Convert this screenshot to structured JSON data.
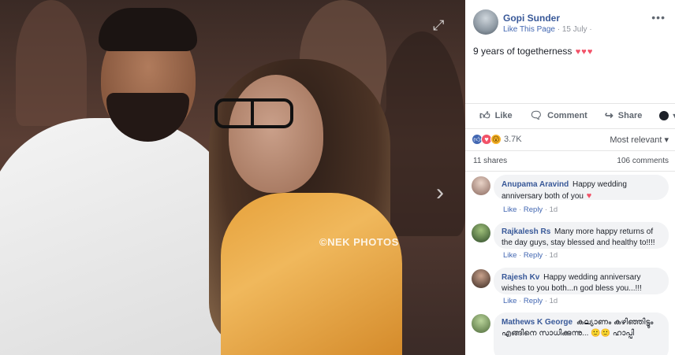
{
  "photo": {
    "watermark": "©NEK PHOTOS",
    "expand_icon": "expand-icon",
    "next_icon": "chevron-right-icon"
  },
  "post": {
    "author": "Gopi Sunder",
    "like_page": "Like This Page",
    "separator": "·",
    "date": "15 July",
    "text": "9 years of togetherness",
    "hearts": [
      "♥",
      "♥",
      "♥"
    ],
    "heart_color": "#f25268"
  },
  "actions": {
    "like": "Like",
    "comment": "Comment",
    "share": "Share"
  },
  "reactions": {
    "count": "3.7K",
    "sort": "Most relevant ▾",
    "types": [
      "like",
      "love",
      "wow"
    ]
  },
  "stats": {
    "shares": "11 shares",
    "comments": "106 comments"
  },
  "comments": [
    {
      "author": "Anupama Aravind",
      "text": "Happy wedding anniversary both of you",
      "emoji": "♥",
      "like": "Like",
      "reply": "Reply",
      "time": "1d"
    },
    {
      "author": "Rajkalesh Rs",
      "text": "Many more happy returns of the day guys, stay blessed and healthy to!!!!",
      "like": "Like",
      "reply": "Reply",
      "time": "1d"
    },
    {
      "author": "Rajesh Kv",
      "text": "Happy wedding anniversary wishes to you both...n god bless you...!!!",
      "like": "Like",
      "reply": "Reply",
      "time": "1d"
    },
    {
      "author": "Mathews K George",
      "text": "കല്യാണം കഴിഞ്ഞിട്ടും എങ്ങിനെ സാധിക്കുന്നു... 🙂🙂 ഹാപ്പി"
    }
  ],
  "colors": {
    "link_blue": "#385898",
    "action_blue": "#4267b2",
    "bubble_bg": "#f2f3f5"
  }
}
